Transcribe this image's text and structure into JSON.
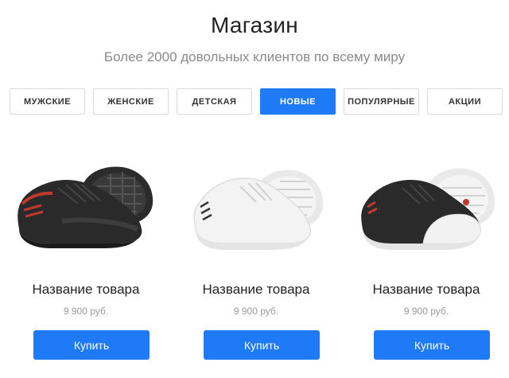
{
  "header": {
    "title": "Магазин",
    "subtitle": "Более 2000 довольных клиентов по всему миру"
  },
  "tabs": [
    {
      "label": "Мужские",
      "active": false
    },
    {
      "label": "Женские",
      "active": false
    },
    {
      "label": "Детская",
      "active": false
    },
    {
      "label": "Новые",
      "active": true
    },
    {
      "label": "Популярные",
      "active": false
    },
    {
      "label": "Акции",
      "active": false
    }
  ],
  "products": [
    {
      "name": "Название товара",
      "price": "9 900 руб.",
      "button": "Купить",
      "image_icon": "black-sneaker-icon"
    },
    {
      "name": "Название товара",
      "price": "9 900 руб.",
      "button": "Купить",
      "image_icon": "white-sneaker-icon"
    },
    {
      "name": "Название товара",
      "price": "9 900 руб.",
      "button": "Купить",
      "image_icon": "black-white-sneaker-icon"
    }
  ],
  "colors": {
    "accent": "#1e7af7",
    "tab_border": "#d9d9d9",
    "subtitle": "#8a8a8a",
    "price": "#9a9a9a"
  }
}
